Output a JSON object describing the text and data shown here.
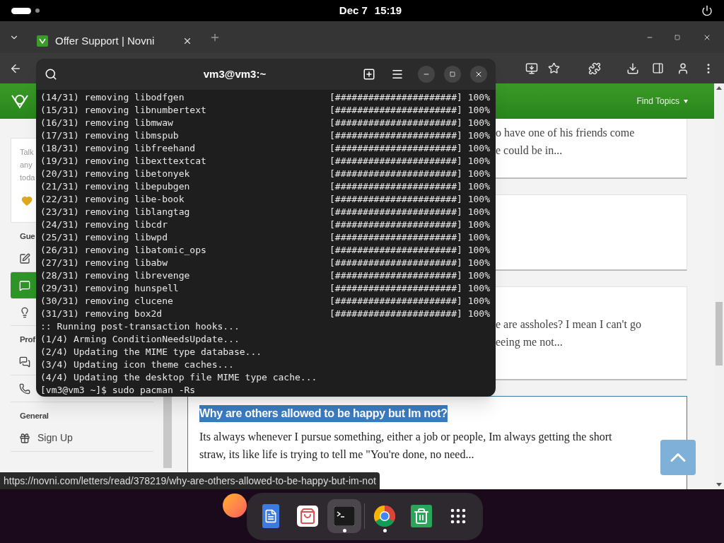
{
  "top_bar": {
    "date": "Dec 7",
    "time": "15:19"
  },
  "browser": {
    "tabs": [
      {
        "title": "Offer Support | Novni",
        "selected": true
      }
    ]
  },
  "site": {
    "nav": "Find Topics"
  },
  "sidebar": {
    "card_lines": [
      "Talk",
      "any",
      "toda"
    ],
    "sections": [
      {
        "heading": "Gue",
        "items": [
          {
            "kind": "edit",
            "selected": false
          },
          {
            "kind": "chat",
            "selected": true
          },
          {
            "kind": "bulb",
            "selected": false
          }
        ]
      },
      {
        "heading": "Prof",
        "items": [
          {
            "kind": "chats",
            "selected": false
          },
          {
            "kind": "phone",
            "selected": false
          }
        ]
      },
      {
        "heading": "General",
        "items": [
          {
            "kind": "gift",
            "label": "Sign Up",
            "selected": false
          }
        ]
      }
    ]
  },
  "posts": [
    {
      "lines": [
        "o have one of his friends come",
        "e could be in..."
      ],
      "selected": false
    },
    {
      "selected": false
    },
    {
      "lines": [
        "e are assholes? I mean I can't go",
        "eeing me not..."
      ],
      "selected": false
    },
    {
      "title": "Why are others allowed to be happy but Im not?",
      "lines": [
        "Its always whenever I pursue something, either a job or people, Im always getting the short",
        "straw, its like life is trying to tell me \"You're done, no need..."
      ],
      "selected": true
    }
  ],
  "terminal": {
    "title": "vm3@vm3:~",
    "lines": [
      {
        "text": "(14/31) removing libodfgen",
        "progress": "[######################] 100%"
      },
      {
        "text": "(15/31) removing libnumbertext",
        "progress": "[######################] 100%"
      },
      {
        "text": "(16/31) removing libmwaw",
        "progress": "[######################] 100%"
      },
      {
        "text": "(17/31) removing libmspub",
        "progress": "[######################] 100%"
      },
      {
        "text": "(18/31) removing libfreehand",
        "progress": "[######################] 100%"
      },
      {
        "text": "(19/31) removing libexttextcat",
        "progress": "[######################] 100%"
      },
      {
        "text": "(20/31) removing libetonyek",
        "progress": "[######################] 100%"
      },
      {
        "text": "(21/31) removing libepubgen",
        "progress": "[######################] 100%"
      },
      {
        "text": "(22/31) removing libe-book",
        "progress": "[######################] 100%"
      },
      {
        "text": "(23/31) removing liblangtag",
        "progress": "[######################] 100%"
      },
      {
        "text": "(24/31) removing libcdr",
        "progress": "[######################] 100%"
      },
      {
        "text": "(25/31) removing libwpd",
        "progress": "[######################] 100%"
      },
      {
        "text": "(26/31) removing libatomic_ops",
        "progress": "[######################] 100%"
      },
      {
        "text": "(27/31) removing libabw",
        "progress": "[######################] 100%"
      },
      {
        "text": "(28/31) removing librevenge",
        "progress": "[######################] 100%"
      },
      {
        "text": "(29/31) removing hunspell",
        "progress": "[######################] 100%"
      },
      {
        "text": "(30/31) removing clucene",
        "progress": "[######################] 100%"
      },
      {
        "text": "(31/31) removing box2d",
        "progress": "[######################] 100%"
      },
      {
        "text": ":: Running post-transaction hooks..."
      },
      {
        "text": "(1/4) Arming ConditionNeedsUpdate..."
      },
      {
        "text": "(2/4) Updating the MIME type database..."
      },
      {
        "text": "(3/4) Updating icon theme caches..."
      },
      {
        "text": "(4/4) Updating the desktop file MIME type cache..."
      },
      {
        "text": "[vm3@vm3 ~]$ sudo pacman -Rs"
      }
    ]
  },
  "status_url": "https://novni.com/letters/read/378219/why-are-others-allowed-to-be-happy-but-im-not",
  "dock": {
    "apps": [
      {
        "kind": "files",
        "focused": false,
        "running": false
      },
      {
        "kind": "software",
        "focused": false,
        "running": false
      },
      {
        "kind": "terminal",
        "focused": true,
        "running": true
      },
      {
        "kind": "chrome",
        "focused": false,
        "running": true
      },
      {
        "kind": "trash",
        "focused": false,
        "running": false
      },
      {
        "kind": "grid",
        "focused": false,
        "running": false
      }
    ]
  }
}
